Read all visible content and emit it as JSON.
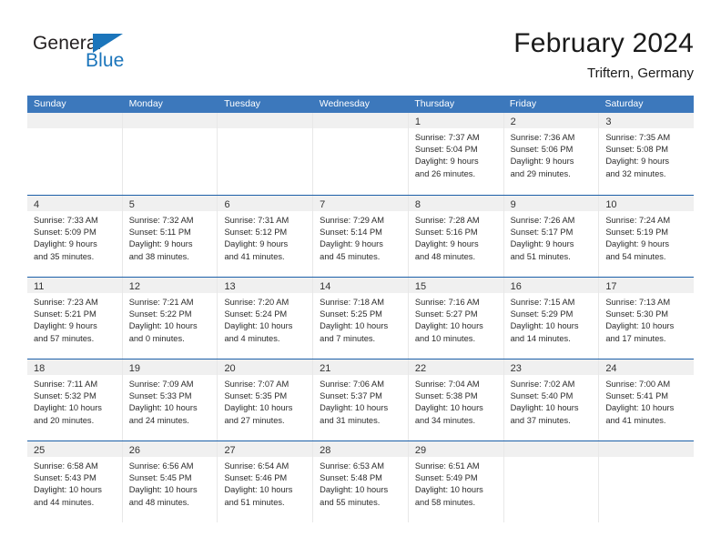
{
  "brand": {
    "name_part1": "General",
    "name_part2": "Blue",
    "triangle_color": "#1b75bb"
  },
  "header": {
    "title": "February 2024",
    "subtitle": "Triftern, Germany"
  },
  "colors": {
    "header_blue": "#3c78bc",
    "row_rule": "#1b5fa8",
    "daynum_band": "#f0f0f0"
  },
  "weekdays": [
    "Sunday",
    "Monday",
    "Tuesday",
    "Wednesday",
    "Thursday",
    "Friday",
    "Saturday"
  ],
  "weeks": [
    [
      {
        "day": "",
        "sunrise": "",
        "sunset": "",
        "daylight1": "",
        "daylight2": ""
      },
      {
        "day": "",
        "sunrise": "",
        "sunset": "",
        "daylight1": "",
        "daylight2": ""
      },
      {
        "day": "",
        "sunrise": "",
        "sunset": "",
        "daylight1": "",
        "daylight2": ""
      },
      {
        "day": "",
        "sunrise": "",
        "sunset": "",
        "daylight1": "",
        "daylight2": ""
      },
      {
        "day": "1",
        "sunrise": "Sunrise: 7:37 AM",
        "sunset": "Sunset: 5:04 PM",
        "daylight1": "Daylight: 9 hours",
        "daylight2": "and 26 minutes."
      },
      {
        "day": "2",
        "sunrise": "Sunrise: 7:36 AM",
        "sunset": "Sunset: 5:06 PM",
        "daylight1": "Daylight: 9 hours",
        "daylight2": "and 29 minutes."
      },
      {
        "day": "3",
        "sunrise": "Sunrise: 7:35 AM",
        "sunset": "Sunset: 5:08 PM",
        "daylight1": "Daylight: 9 hours",
        "daylight2": "and 32 minutes."
      }
    ],
    [
      {
        "day": "4",
        "sunrise": "Sunrise: 7:33 AM",
        "sunset": "Sunset: 5:09 PM",
        "daylight1": "Daylight: 9 hours",
        "daylight2": "and 35 minutes."
      },
      {
        "day": "5",
        "sunrise": "Sunrise: 7:32 AM",
        "sunset": "Sunset: 5:11 PM",
        "daylight1": "Daylight: 9 hours",
        "daylight2": "and 38 minutes."
      },
      {
        "day": "6",
        "sunrise": "Sunrise: 7:31 AM",
        "sunset": "Sunset: 5:12 PM",
        "daylight1": "Daylight: 9 hours",
        "daylight2": "and 41 minutes."
      },
      {
        "day": "7",
        "sunrise": "Sunrise: 7:29 AM",
        "sunset": "Sunset: 5:14 PM",
        "daylight1": "Daylight: 9 hours",
        "daylight2": "and 45 minutes."
      },
      {
        "day": "8",
        "sunrise": "Sunrise: 7:28 AM",
        "sunset": "Sunset: 5:16 PM",
        "daylight1": "Daylight: 9 hours",
        "daylight2": "and 48 minutes."
      },
      {
        "day": "9",
        "sunrise": "Sunrise: 7:26 AM",
        "sunset": "Sunset: 5:17 PM",
        "daylight1": "Daylight: 9 hours",
        "daylight2": "and 51 minutes."
      },
      {
        "day": "10",
        "sunrise": "Sunrise: 7:24 AM",
        "sunset": "Sunset: 5:19 PM",
        "daylight1": "Daylight: 9 hours",
        "daylight2": "and 54 minutes."
      }
    ],
    [
      {
        "day": "11",
        "sunrise": "Sunrise: 7:23 AM",
        "sunset": "Sunset: 5:21 PM",
        "daylight1": "Daylight: 9 hours",
        "daylight2": "and 57 minutes."
      },
      {
        "day": "12",
        "sunrise": "Sunrise: 7:21 AM",
        "sunset": "Sunset: 5:22 PM",
        "daylight1": "Daylight: 10 hours",
        "daylight2": "and 0 minutes."
      },
      {
        "day": "13",
        "sunrise": "Sunrise: 7:20 AM",
        "sunset": "Sunset: 5:24 PM",
        "daylight1": "Daylight: 10 hours",
        "daylight2": "and 4 minutes."
      },
      {
        "day": "14",
        "sunrise": "Sunrise: 7:18 AM",
        "sunset": "Sunset: 5:25 PM",
        "daylight1": "Daylight: 10 hours",
        "daylight2": "and 7 minutes."
      },
      {
        "day": "15",
        "sunrise": "Sunrise: 7:16 AM",
        "sunset": "Sunset: 5:27 PM",
        "daylight1": "Daylight: 10 hours",
        "daylight2": "and 10 minutes."
      },
      {
        "day": "16",
        "sunrise": "Sunrise: 7:15 AM",
        "sunset": "Sunset: 5:29 PM",
        "daylight1": "Daylight: 10 hours",
        "daylight2": "and 14 minutes."
      },
      {
        "day": "17",
        "sunrise": "Sunrise: 7:13 AM",
        "sunset": "Sunset: 5:30 PM",
        "daylight1": "Daylight: 10 hours",
        "daylight2": "and 17 minutes."
      }
    ],
    [
      {
        "day": "18",
        "sunrise": "Sunrise: 7:11 AM",
        "sunset": "Sunset: 5:32 PM",
        "daylight1": "Daylight: 10 hours",
        "daylight2": "and 20 minutes."
      },
      {
        "day": "19",
        "sunrise": "Sunrise: 7:09 AM",
        "sunset": "Sunset: 5:33 PM",
        "daylight1": "Daylight: 10 hours",
        "daylight2": "and 24 minutes."
      },
      {
        "day": "20",
        "sunrise": "Sunrise: 7:07 AM",
        "sunset": "Sunset: 5:35 PM",
        "daylight1": "Daylight: 10 hours",
        "daylight2": "and 27 minutes."
      },
      {
        "day": "21",
        "sunrise": "Sunrise: 7:06 AM",
        "sunset": "Sunset: 5:37 PM",
        "daylight1": "Daylight: 10 hours",
        "daylight2": "and 31 minutes."
      },
      {
        "day": "22",
        "sunrise": "Sunrise: 7:04 AM",
        "sunset": "Sunset: 5:38 PM",
        "daylight1": "Daylight: 10 hours",
        "daylight2": "and 34 minutes."
      },
      {
        "day": "23",
        "sunrise": "Sunrise: 7:02 AM",
        "sunset": "Sunset: 5:40 PM",
        "daylight1": "Daylight: 10 hours",
        "daylight2": "and 37 minutes."
      },
      {
        "day": "24",
        "sunrise": "Sunrise: 7:00 AM",
        "sunset": "Sunset: 5:41 PM",
        "daylight1": "Daylight: 10 hours",
        "daylight2": "and 41 minutes."
      }
    ],
    [
      {
        "day": "25",
        "sunrise": "Sunrise: 6:58 AM",
        "sunset": "Sunset: 5:43 PM",
        "daylight1": "Daylight: 10 hours",
        "daylight2": "and 44 minutes."
      },
      {
        "day": "26",
        "sunrise": "Sunrise: 6:56 AM",
        "sunset": "Sunset: 5:45 PM",
        "daylight1": "Daylight: 10 hours",
        "daylight2": "and 48 minutes."
      },
      {
        "day": "27",
        "sunrise": "Sunrise: 6:54 AM",
        "sunset": "Sunset: 5:46 PM",
        "daylight1": "Daylight: 10 hours",
        "daylight2": "and 51 minutes."
      },
      {
        "day": "28",
        "sunrise": "Sunrise: 6:53 AM",
        "sunset": "Sunset: 5:48 PM",
        "daylight1": "Daylight: 10 hours",
        "daylight2": "and 55 minutes."
      },
      {
        "day": "29",
        "sunrise": "Sunrise: 6:51 AM",
        "sunset": "Sunset: 5:49 PM",
        "daylight1": "Daylight: 10 hours",
        "daylight2": "and 58 minutes."
      },
      {
        "day": "",
        "sunrise": "",
        "sunset": "",
        "daylight1": "",
        "daylight2": ""
      },
      {
        "day": "",
        "sunrise": "",
        "sunset": "",
        "daylight1": "",
        "daylight2": ""
      }
    ]
  ]
}
